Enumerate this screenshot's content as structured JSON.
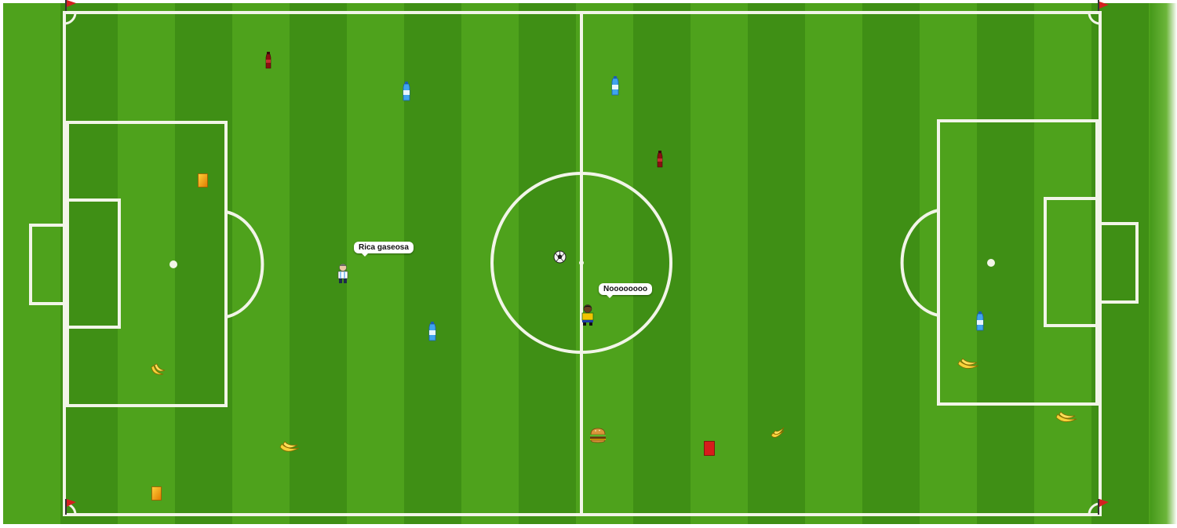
{
  "speech": {
    "bubble_1": "Rica gaseosa",
    "bubble_2": "Noooooooo"
  },
  "colors": {
    "grass_light": "#4ea21c",
    "grass_dark": "#3f8f15",
    "lines": "#f2f5e8",
    "flag": "#d42020",
    "bottle": "#2a8fe0",
    "player_shirt": "#f2c400",
    "yellow_card": "#f4b400",
    "red_card": "#d81b1b"
  },
  "icons": [
    "soccer-ball-icon",
    "water-bottle-icon",
    "banana-icon",
    "burger-icon",
    "yellow-card-icon",
    "red-card-icon",
    "corner-flag-icon",
    "player-avatar-icon",
    "soda-bottle-icon"
  ]
}
